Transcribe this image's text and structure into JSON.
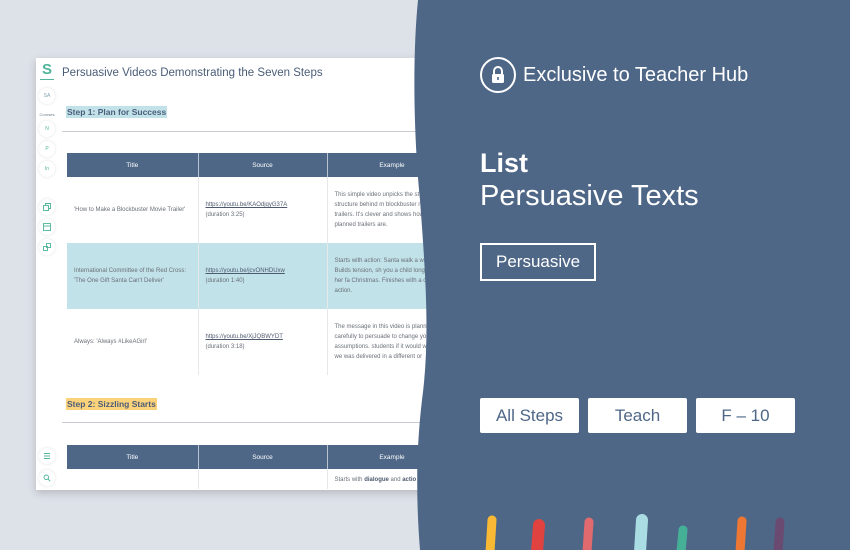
{
  "app": {
    "logo": "S",
    "avatar": "SA",
    "rail_label": "Courses",
    "courses": [
      "N",
      "P",
      "In"
    ],
    "page_title": "Persuasive Videos Demonstrating the Seven Steps"
  },
  "sections": [
    {
      "heading": "Step 1: Plan for Success",
      "columns": [
        "Title",
        "Source",
        "Example"
      ],
      "rows": [
        {
          "title": "'How to Make a Blockbuster Movie Trailer'",
          "link": "https://youtu.be/KAOdjqyG37A",
          "duration": "(duration 3:25)",
          "example": "This simple video unpicks the standard structure behind m blockbuster movie trailers. It's clever and shows how tightly planned trailers are."
        },
        {
          "title": "International Committee of the Red Cross: 'The One Gift Santa Can't Deliver'",
          "link": "https://youtu.be/jcvONHDUxw",
          "duration": "(duration 1:40)",
          "example": "Starts with action: Santa walk a war zone. Builds tension, sh you a child longing for her fa Christmas. Finishes with a cal action."
        },
        {
          "title": "Always: 'Always #LikeAGirl'",
          "link": "https://youtu.be/XjJQBWYDT",
          "duration": "(duration 3:18)",
          "example": "The message in this video is planned carefully to persuade to change your assumptions. students if it would work as we was delivered in a different or"
        }
      ]
    },
    {
      "heading": "Step 2: Sizzling Starts",
      "columns": [
        "Title",
        "Source",
        "Example"
      ],
      "partial_row": {
        "prefix": "Starts with ",
        "bold1": "dialogue",
        "mid": " and ",
        "bold2": "actio"
      }
    }
  ],
  "promo": {
    "exclusive_label": "Exclusive to Teacher Hub",
    "kicker": "List",
    "title": "Persuasive Texts",
    "category_tag": "Persuasive",
    "chips": [
      "All Steps",
      "Teach",
      "F – 10"
    ],
    "colors": {
      "panel": "#4e6787",
      "strokes": [
        "#f9b934",
        "#e0433f",
        "#e06a6e",
        "#a9dde3",
        "#46b097",
        "#ee7833",
        "#6b4a72"
      ]
    }
  }
}
